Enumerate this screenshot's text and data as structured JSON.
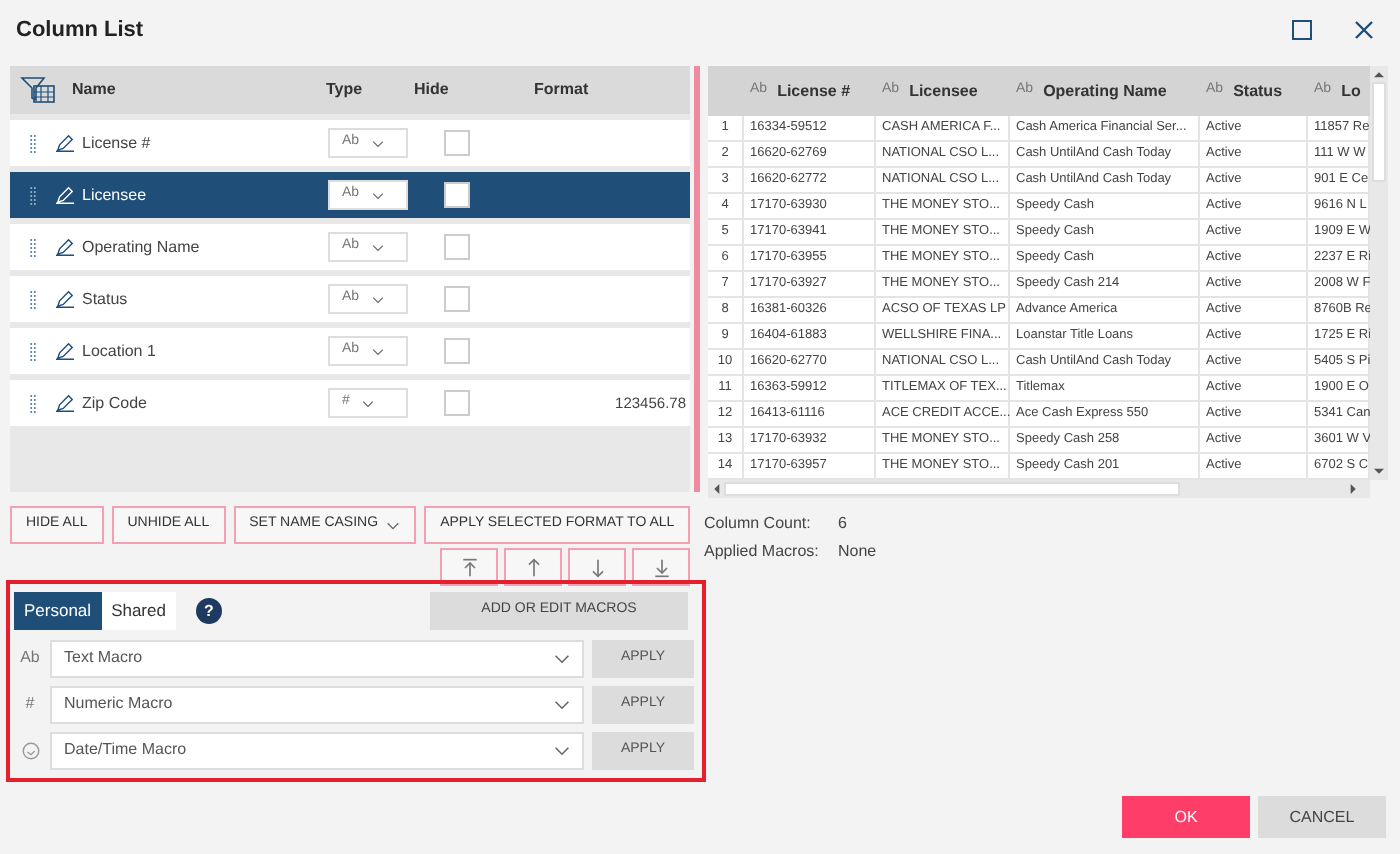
{
  "window": {
    "title": "Column List"
  },
  "column_list": {
    "headers": [
      "Name",
      "Type",
      "Hide",
      "Format"
    ],
    "rows": [
      {
        "name": "License #",
        "type": "Ab",
        "hidden": false,
        "selected": false
      },
      {
        "name": "Licensee",
        "type": "Ab",
        "hidden": false,
        "selected": true
      },
      {
        "name": "Operating Name",
        "type": "Ab",
        "hidden": false,
        "selected": false
      },
      {
        "name": "Status",
        "type": "Ab",
        "hidden": false,
        "selected": false
      },
      {
        "name": "Location 1",
        "type": "Ab",
        "hidden": false,
        "selected": false
      },
      {
        "name": "Zip Code",
        "type": "#",
        "hidden": false,
        "selected": false,
        "format": "123456.78"
      }
    ]
  },
  "preview": {
    "columns": [
      {},
      {
        "type": "Ab",
        "title": "License #"
      },
      {
        "type": "Ab",
        "title": "Licensee"
      },
      {
        "type": "Ab",
        "title": "Operating Name"
      },
      {
        "type": "Ab",
        "title": "Status"
      },
      {
        "type": "Ab",
        "title": "Lo"
      }
    ],
    "rows": [
      [
        "1",
        "16334-59512",
        "CASH AMERICA F...",
        "Cash America Financial Ser...",
        "Active",
        "11857 Re"
      ],
      [
        "2",
        "16620-62769",
        "NATIONAL CSO L...",
        "Cash UntilAnd Cash Today",
        "Active",
        "111 W W"
      ],
      [
        "3",
        "16620-62772",
        "NATIONAL CSO L...",
        "Cash UntilAnd Cash Today",
        "Active",
        "901 E Ce"
      ],
      [
        "4",
        "17170-63930",
        "THE MONEY STO...",
        "Speedy Cash",
        "Active",
        "9616 N L"
      ],
      [
        "5",
        "17170-63941",
        "THE MONEY STO...",
        "Speedy Cash",
        "Active",
        "1909 E W"
      ],
      [
        "6",
        "17170-63955",
        "THE MONEY STO...",
        "Speedy Cash",
        "Active",
        "2237 E Ri"
      ],
      [
        "7",
        "17170-63927",
        "THE MONEY STO...",
        "Speedy Cash 214",
        "Active",
        "2008 W F"
      ],
      [
        "8",
        "16381-60326",
        "ACSO OF TEXAS LP",
        "Advance America",
        "Active",
        "8760B Re"
      ],
      [
        "9",
        "16404-61883",
        "WELLSHIRE FINA...",
        "Loanstar Title Loans",
        "Active",
        "1725 E Ri"
      ],
      [
        "10",
        "16620-62770",
        "NATIONAL CSO L...",
        "Cash UntilAnd Cash Today",
        "Active",
        "5405 S Pi"
      ],
      [
        "11",
        "16363-59912",
        "TITLEMAX OF TEX...",
        "Titlemax",
        "Active",
        "1900 E O"
      ],
      [
        "12",
        "16413-61116",
        "ACE CREDIT ACCE...",
        "Ace Cash Express 550",
        "Active",
        "5341 Can"
      ],
      [
        "13",
        "17170-63932",
        "THE MONEY STO...",
        "Speedy Cash 258",
        "Active",
        "3601 W V"
      ],
      [
        "14",
        "17170-63957",
        "THE MONEY STO...",
        "Speedy Cash 201",
        "Active",
        "6702 S C"
      ]
    ]
  },
  "actions": [
    {
      "label": "HIDE ALL",
      "kind": "plain"
    },
    {
      "label": "UNHIDE ALL",
      "kind": "plain"
    },
    {
      "label": "SET NAME CASING",
      "kind": "dropdown"
    },
    {
      "label": "APPLY SELECTED FORMAT TO ALL",
      "kind": "plain"
    }
  ],
  "move_buttons": [
    {
      "kind": "top"
    },
    {
      "kind": "up"
    },
    {
      "kind": "down"
    },
    {
      "kind": "bottom"
    }
  ],
  "macros": {
    "tabs": [
      {
        "label": "Personal",
        "selected": true
      },
      {
        "label": "Shared",
        "selected": false
      }
    ],
    "help": "?",
    "add_button": "ADD OR EDIT MACROS",
    "rows": [
      {
        "kind": "label",
        "icon": "Ab",
        "placeholder": "Text Macro",
        "button": "APPLY"
      },
      {
        "kind": "label",
        "icon": "#",
        "placeholder": "Numeric Macro",
        "button": "APPLY"
      },
      {
        "kind": "clock",
        "placeholder": "Date/Time Macro",
        "button": "APPLY"
      }
    ]
  },
  "summary": [
    {
      "label": "Column Count:",
      "value": "6"
    },
    {
      "label": "Applied Macros:",
      "value": "None"
    }
  ],
  "footer": {
    "ok": "OK",
    "cancel": "CANCEL"
  }
}
